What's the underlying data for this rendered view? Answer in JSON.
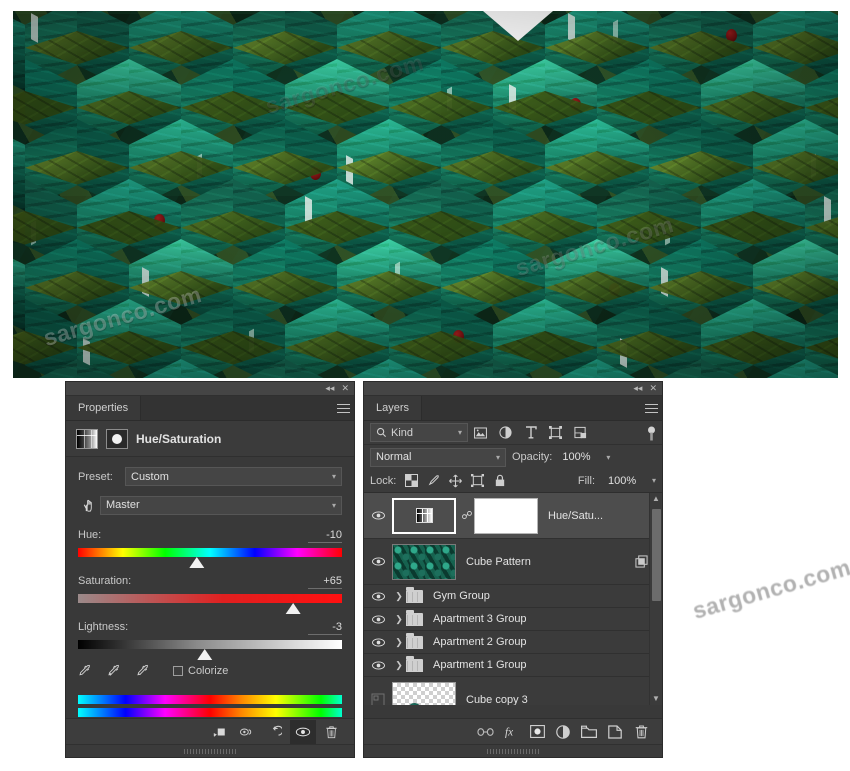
{
  "artwork": {
    "name": "isometric-cube-apartment-pattern",
    "watermarks": [
      "sargonco.com",
      "sargonco.com",
      "sargonco.com",
      "sargonco.com",
      "sargonco.com",
      "sargonco.com"
    ]
  },
  "properties_panel": {
    "tab_label": "Properties",
    "collapse_icon": "◂◂",
    "close_icon": "✕",
    "menu_icon": "hamburger-menu-icon",
    "adjustment_title": "Hue/Saturation",
    "preset_label": "Preset:",
    "preset_value": "Custom",
    "channel_value": "Master",
    "sliders": [
      {
        "label": "Hue:",
        "value": "-10",
        "percent": 45.0
      },
      {
        "label": "Saturation:",
        "value": "+65",
        "percent": 81.5
      },
      {
        "label": "Lightness:",
        "value": "-3",
        "percent": 48.0
      }
    ],
    "colorize_label": "Colorize",
    "colorize_checked": false,
    "footer_buttons": [
      "clip-to-layer-button",
      "view-previous-state-button",
      "reset-button",
      "toggle-visibility-button",
      "delete-adjustment-button"
    ]
  },
  "layers_panel": {
    "tab_label": "Layers",
    "collapse_icon": "◂◂",
    "close_icon": "✕",
    "menu_icon": "hamburger-menu-icon",
    "filter": {
      "kind_label": "Kind",
      "icons": [
        "pixel-layer-filter-icon",
        "adjustment-layer-filter-icon",
        "type-layer-filter-icon",
        "shape-layer-filter-icon",
        "smart-object-filter-icon"
      ],
      "toggle_name": "filter-enable-toggle"
    },
    "blend_mode": "Normal",
    "opacity_label": "Opacity:",
    "opacity_value": "100%",
    "lock_label": "Lock:",
    "fill_label": "Fill:",
    "fill_value": "100%",
    "lock_icons": [
      "lock-transparent-pixels-icon",
      "lock-image-pixels-icon",
      "lock-position-icon",
      "lock-artboard-nesting-icon",
      "lock-all-icon"
    ],
    "layers": [
      {
        "name": "Hue/Satu...",
        "type": "adjustment",
        "visible": true,
        "selected": true,
        "linked": true
      },
      {
        "name": "Cube Pattern",
        "type": "smart-object",
        "visible": true,
        "selected": false
      },
      {
        "name": "Gym Group",
        "type": "group",
        "visible": true,
        "selected": false
      },
      {
        "name": "Apartment 3 Group",
        "type": "group",
        "visible": true,
        "selected": false
      },
      {
        "name": "Apartment 2 Group",
        "type": "group",
        "visible": true,
        "selected": false
      },
      {
        "name": "Apartment 1 Group",
        "type": "group",
        "visible": true,
        "selected": false
      },
      {
        "name": "Cube copy 3",
        "type": "smart-object",
        "visible": false,
        "selected": false
      }
    ],
    "footer_buttons": [
      "link-layers-button",
      "add-layer-style-button",
      "add-layer-mask-button",
      "new-adjustment-layer-button",
      "new-group-button",
      "new-layer-button",
      "delete-layer-button"
    ],
    "footer_glyphs": {
      "link": "∞",
      "fx": "fx",
      "mask": "mask-icon",
      "adjust": "half-circle-icon",
      "group": "folder-icon",
      "new": "page-icon",
      "trash": "🗑"
    }
  },
  "colors": {
    "panel_bg": "#3b3b3b",
    "panel_bg_dark": "#333333",
    "selected_row": "#4d4d4d",
    "text": "#e0e0e0",
    "muted_text": "#c0c0c0",
    "border": "#2e2e2e"
  }
}
